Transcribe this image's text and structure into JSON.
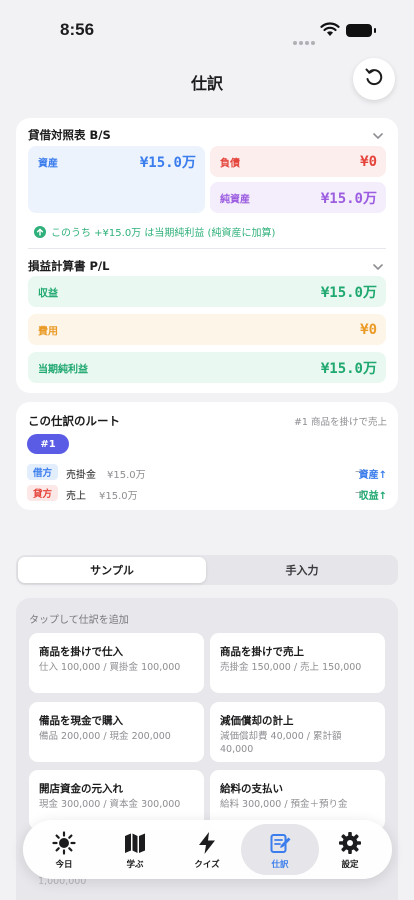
{
  "status": {
    "time": "8:56"
  },
  "nav": {
    "title": "仕訳"
  },
  "balance_sheet": {
    "title": "貸借対照表 B/S",
    "assets": {
      "label": "資産",
      "value": "¥15.0万"
    },
    "liabilities": {
      "label": "負債",
      "value": "¥0"
    },
    "equity": {
      "label": "純資産",
      "value": "¥15.0万"
    },
    "note": "このうち +¥15.0万 は当期純利益 (純資産に加算)"
  },
  "income_statement": {
    "title": "損益計算書 P/L",
    "revenue": {
      "label": "収益",
      "value": "¥15.0万"
    },
    "expenses": {
      "label": "費用",
      "value": "¥0"
    },
    "net_income": {
      "label": "当期純利益",
      "value": "¥15.0万"
    }
  },
  "route": {
    "title": "この仕訳のルート",
    "subtitle": "#1 商品を掛けで売上",
    "badge": "#1",
    "rows": [
      {
        "side": "借方",
        "account": "売掛金",
        "amount": "¥15.0万",
        "arrow": "→",
        "effect": "資産↑"
      },
      {
        "side": "貸方",
        "account": "売上",
        "amount": "¥15.0万",
        "arrow": "→",
        "effect": "収益↑"
      }
    ]
  },
  "segments": {
    "sample": "サンプル",
    "manual": "手入力"
  },
  "samples": {
    "hint": "タップして仕訳を追加",
    "items": [
      {
        "title": "商品を掛けで仕入",
        "detail": "仕入 100,000 / 買掛金 100,000"
      },
      {
        "title": "商品を掛けで売上",
        "detail": "売掛金 150,000 / 売上 150,000"
      },
      {
        "title": "備品を現金で購入",
        "detail": "備品 200,000 / 現金 200,000"
      },
      {
        "title": "減価償却の計上",
        "detail": "減価償却費 40,000 / 累計額 40,000"
      },
      {
        "title": "開店資金の元入れ",
        "detail": "現金 300,000 / 資本金 300,000"
      },
      {
        "title": "給料の支払い",
        "detail": "給料 300,000 / 預金＋預り金"
      }
    ],
    "faded_amount": "1,000,000"
  },
  "tabs": [
    {
      "label": "今日",
      "icon": "sun-icon"
    },
    {
      "label": "学ぶ",
      "icon": "map-icon"
    },
    {
      "label": "クイズ",
      "icon": "bolt-icon"
    },
    {
      "label": "仕訳",
      "icon": "journal-edit-icon"
    },
    {
      "label": "設定",
      "icon": "gear-icon"
    }
  ],
  "colors": {
    "assets": "#3b7ded",
    "liabilities": "#e5443b",
    "equity": "#9c5de0",
    "revenue": "#1fa870",
    "expenses": "#ea9b27",
    "accent": "#5b5ce6"
  }
}
